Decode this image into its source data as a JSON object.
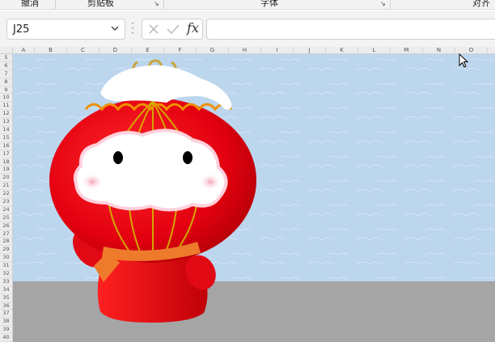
{
  "ribbon": {
    "groups": [
      {
        "label": "撤消"
      },
      {
        "label": "剪贴板"
      },
      {
        "label": "字体"
      },
      {
        "label": "对齐"
      }
    ]
  },
  "formula_bar": {
    "name_box_value": "J25",
    "fx_label": "fx",
    "formula_value": ""
  },
  "columns": [
    "A",
    "B",
    "C",
    "D",
    "E",
    "F",
    "G",
    "H",
    "I",
    "J",
    "K",
    "L",
    "M",
    "N",
    "O"
  ],
  "rows": [
    "5",
    "6",
    "7",
    "8",
    "9",
    "10",
    "11",
    "12",
    "13",
    "14",
    "15",
    "16",
    "17",
    "18",
    "19",
    "20",
    "21",
    "22",
    "23",
    "24",
    "25",
    "26",
    "27",
    "28",
    "29",
    "30",
    "31",
    "32",
    "33",
    "34",
    "35",
    "36",
    "37",
    "38",
    "39",
    "40"
  ],
  "picture": {
    "subject": "red-lantern-mascot",
    "colors": {
      "sky": "#bcd6ee",
      "ground": "#a5a5a5",
      "lantern": "#e8000b",
      "lantern_ribs": "#d4a600",
      "snow": "#ffffff",
      "face": "#ffffff",
      "cheeks": "#f7b3c3",
      "scarf": "#ee7a2b"
    }
  }
}
